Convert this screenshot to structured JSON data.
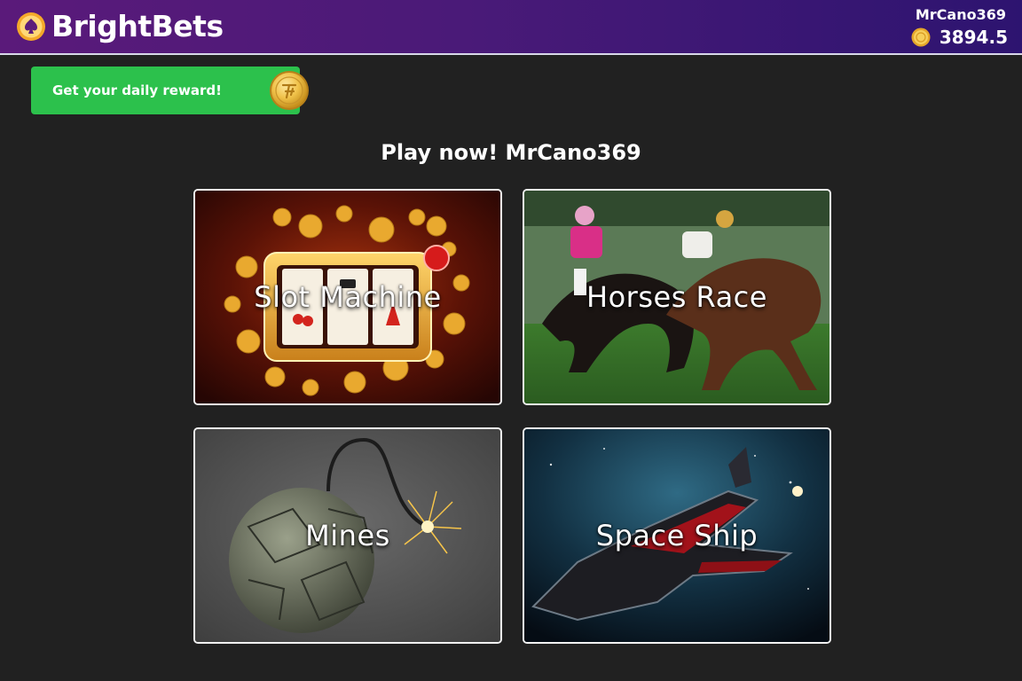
{
  "brand": {
    "name": "BrightBets",
    "logo_icon": "spade-coin-icon"
  },
  "user": {
    "name": "MrCano369",
    "balance": "3894.5",
    "balance_icon": "coin-icon"
  },
  "reward": {
    "label": "Get your daily reward!",
    "icon": "gold-coin-icon"
  },
  "heading": "Play now! MrCano369",
  "games": [
    {
      "label": "Slot Machine",
      "art": "slot-machine-image"
    },
    {
      "label": "Horses Race",
      "art": "horse-race-image"
    },
    {
      "label": "Mines",
      "art": "money-bomb-image"
    },
    {
      "label": "Space Ship",
      "art": "spaceship-image"
    }
  ],
  "colors": {
    "header_start": "#5a1a7a",
    "header_end": "#2d1470",
    "background": "#212121",
    "reward_green": "#2cc14c",
    "coin_gold": "#f2b83a"
  }
}
